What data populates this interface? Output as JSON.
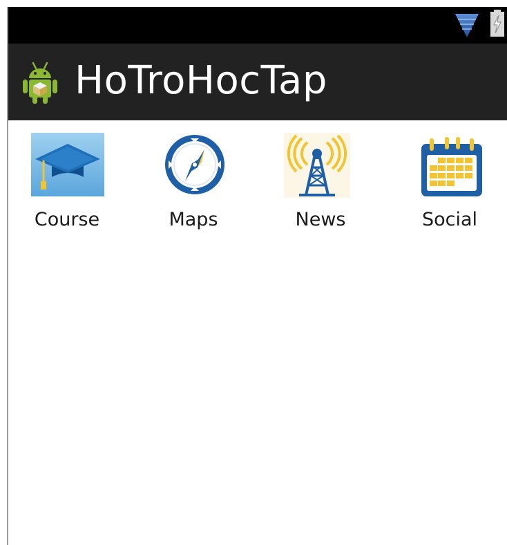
{
  "status_bar": {
    "icons": [
      "wifi-icon",
      "battery-charging-icon"
    ]
  },
  "action_bar": {
    "title": "HoTroHocTap",
    "logo": "android-logo-icon"
  },
  "grid": {
    "items": [
      {
        "label": "Course",
        "icon": "graduation-cap-icon"
      },
      {
        "label": "Maps",
        "icon": "compass-icon"
      },
      {
        "label": "News",
        "icon": "broadcast-tower-icon"
      },
      {
        "label": "Social",
        "icon": "calendar-icon"
      }
    ]
  },
  "colors": {
    "status_bar": "#000000",
    "action_bar": "#222222",
    "title_text": "#ffffff",
    "icon_blue": "#1e5fa6",
    "icon_yellow": "#f4c430",
    "android_green": "#8ab832"
  }
}
